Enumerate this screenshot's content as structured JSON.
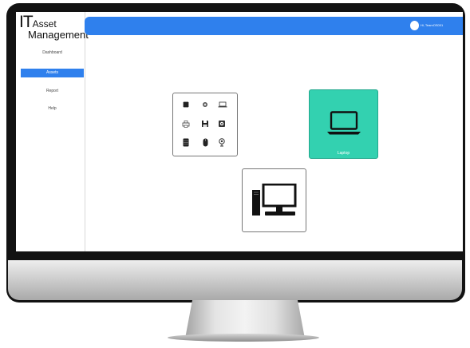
{
  "app": {
    "logo_it": "IT",
    "logo_asset": "Asset",
    "logo_management": "Management"
  },
  "sidebar": {
    "items": [
      {
        "label": "Dashboard",
        "active": false
      },
      {
        "label": "Assets",
        "active": true
      },
      {
        "label": "Report",
        "active": false
      },
      {
        "label": "Help",
        "active": false
      }
    ]
  },
  "header": {
    "greeting": "Hi, TeamOS001"
  },
  "cards": {
    "categories": {
      "icons": [
        "cpu-icon",
        "sensor-icon",
        "laptop-icon",
        "printer-icon",
        "floppy-disk-icon",
        "speaker-icon",
        "server-stack-icon",
        "mouse-icon",
        "webcam-icon"
      ]
    },
    "laptop": {
      "label": "Laptop",
      "icon": "laptop-icon",
      "color": "#33d1b0"
    },
    "desktop": {
      "icon": "desktop-computer-icon"
    }
  },
  "colors": {
    "accent": "#2f80ed",
    "laptop_card": "#33d1b0"
  }
}
